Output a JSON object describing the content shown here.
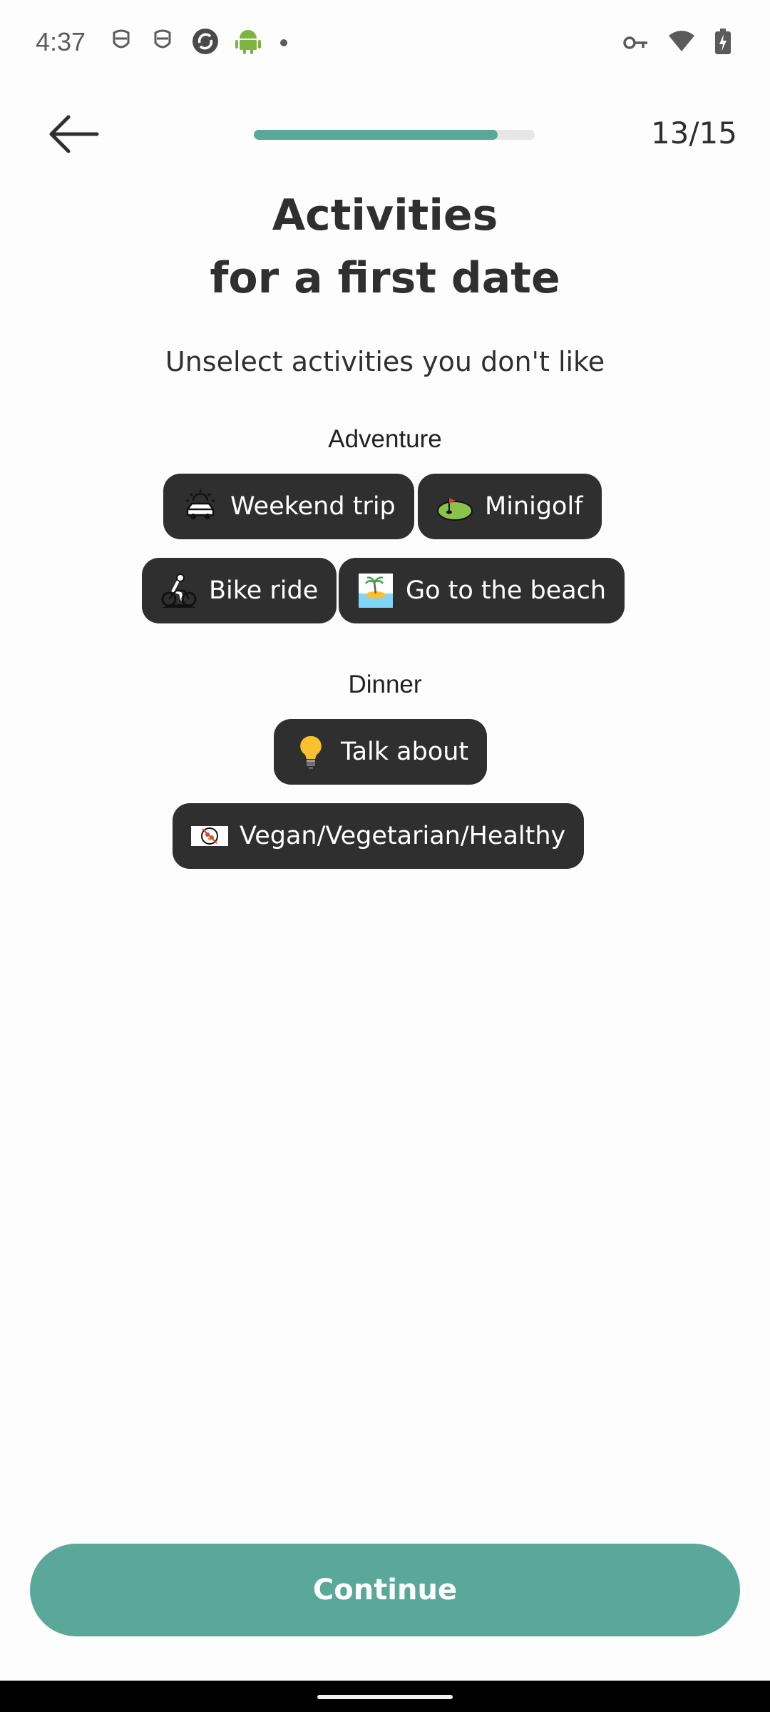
{
  "status_bar": {
    "time": "4:37",
    "left_icons": [
      "privacy-mask-icon",
      "privacy-mask-icon",
      "sync-icon",
      "android-icon",
      "dot-icon"
    ],
    "right_icons": [
      "vpn-key-icon",
      "wifi-icon",
      "battery-charging-icon"
    ]
  },
  "nav": {
    "back_icon": "arrow-left-icon",
    "progress": 0.867,
    "step_counter": "13/15"
  },
  "title": {
    "line1": "Activities",
    "line2": "for a first date"
  },
  "subtitle": "Unselect activities you don't like",
  "sections": [
    {
      "label": "Adventure",
      "chips": [
        {
          "label": "Weekend trip",
          "icon": "car-sunrise-icon"
        },
        {
          "label": "Minigolf",
          "icon": "minigolf-icon"
        },
        {
          "label": "Bike ride",
          "icon": "bike-rider-icon"
        },
        {
          "label": "Go to the beach",
          "icon": "beach-island-icon"
        }
      ]
    },
    {
      "label": "Dinner",
      "chips": [
        {
          "label": "Talk about",
          "icon": "lightbulb-icon"
        },
        {
          "label": "Vegan/Vegetarian/Healthy",
          "icon": "healthy-food-icon"
        }
      ]
    }
  ],
  "continue_label": "Continue",
  "colors": {
    "accent": "#5aa89a",
    "chip_bg": "#2f2f2f",
    "text": "#2f2f2f",
    "background": "#fdfdfd"
  }
}
